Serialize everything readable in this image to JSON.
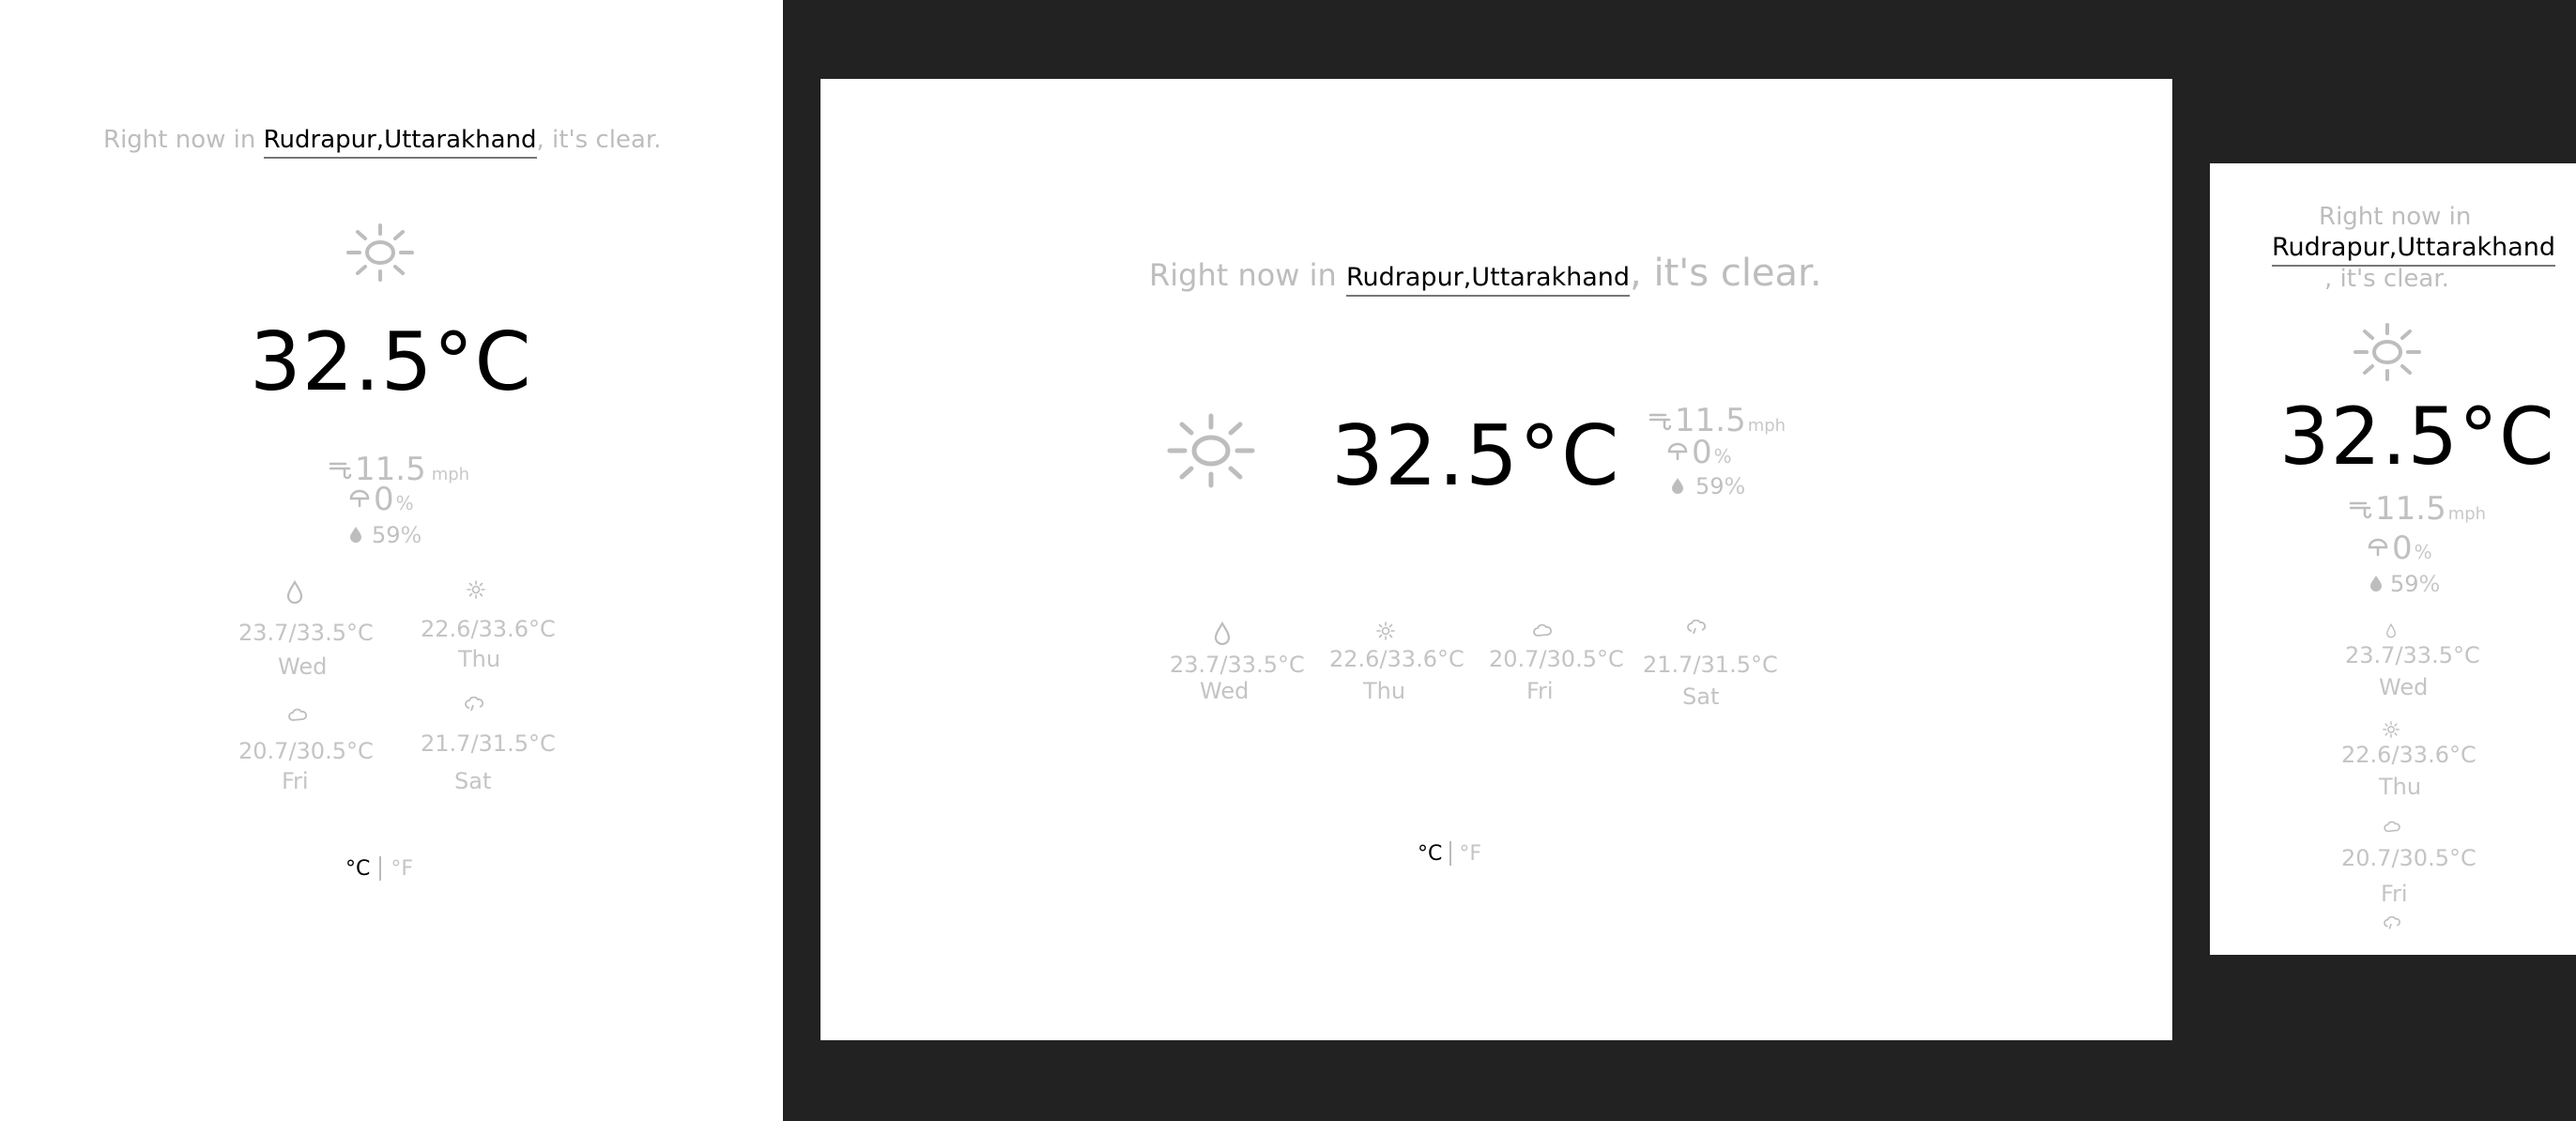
{
  "headline": {
    "prefix": "Right now in",
    "city": "Rudrapur,Uttarakhand",
    "suffix": ", it's clear."
  },
  "current": {
    "temperature": "32.5°C",
    "condition_icon": "sun-icon",
    "wind_value": "11.5",
    "wind_unit": "mph",
    "precip_value": "0",
    "precip_unit": "%",
    "humidity_value": "59",
    "humidity_unit": "%"
  },
  "forecast": [
    {
      "day": "Wed",
      "range": "23.7/33.5°C",
      "icon": "raindrop-icon"
    },
    {
      "day": "Thu",
      "range": "22.6/33.6°C",
      "icon": "sun-icon"
    },
    {
      "day": "Fri",
      "range": "20.7/30.5°C",
      "icon": "cloud-icon"
    },
    {
      "day": "Sat",
      "range": "21.7/31.5°C",
      "icon": "cloud-rain-icon"
    }
  ],
  "units": {
    "celsius": "°C",
    "fahrenheit": "°F"
  },
  "colors": {
    "background": "#ffffff",
    "frame": "#222222",
    "text_muted": "#c4c4c4",
    "text_strong": "#000000"
  }
}
